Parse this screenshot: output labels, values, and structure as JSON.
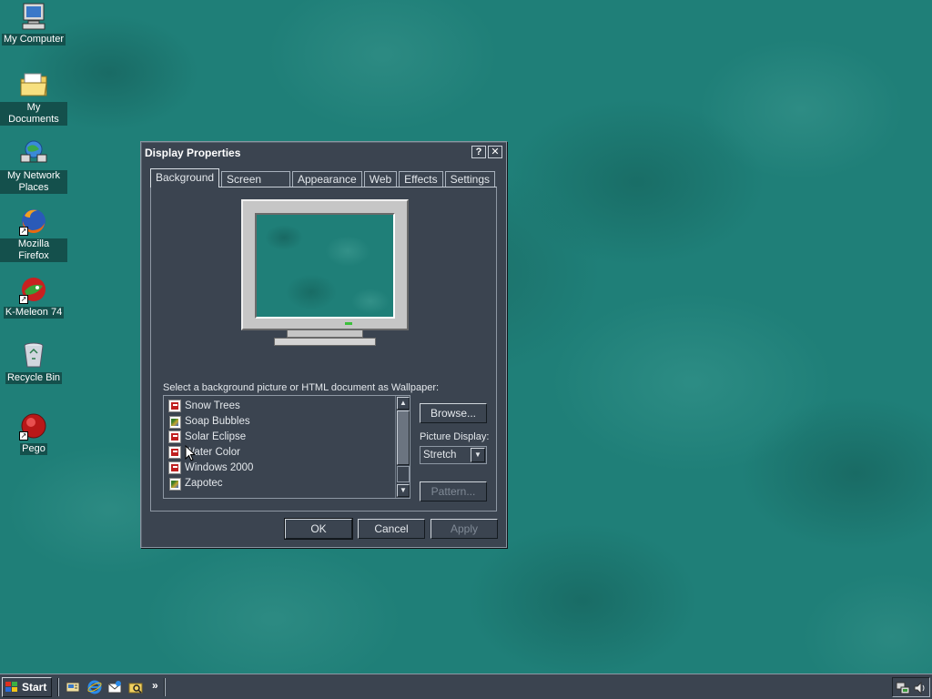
{
  "desktop": {
    "icons": [
      {
        "label": "My Computer",
        "icon": "computer-icon"
      },
      {
        "label": "My Documents",
        "icon": "folder-icon"
      },
      {
        "label": "My Network Places",
        "icon": "network-icon"
      },
      {
        "label": "Mozilla Firefox",
        "icon": "firefox-icon"
      },
      {
        "label": "K-Meleon 74",
        "icon": "kmeleon-icon"
      },
      {
        "label": "Recycle Bin",
        "icon": "recycle-bin-icon"
      },
      {
        "label": "Pego",
        "icon": "pego-icon"
      }
    ]
  },
  "window": {
    "title": "Display Properties",
    "help_glyph": "?",
    "close_glyph": "✕",
    "tabs": [
      "Background",
      "Screen Saver",
      "Appearance",
      "Web",
      "Effects",
      "Settings"
    ],
    "active_tab": "Background",
    "wallpaper_label": "Select a background picture or HTML document as Wallpaper:",
    "wallpapers": [
      {
        "name": "Snow Trees",
        "icon": "bitmap-icon"
      },
      {
        "name": "Soap Bubbles",
        "icon": "html-doc-icon"
      },
      {
        "name": "Solar Eclipse",
        "icon": "bitmap-icon"
      },
      {
        "name": "Water Color",
        "icon": "bitmap-icon"
      },
      {
        "name": "Windows 2000",
        "icon": "bitmap-icon"
      },
      {
        "name": "Zapotec",
        "icon": "html-doc-icon"
      }
    ],
    "browse_label": "Browse...",
    "picture_display_label": "Picture Display:",
    "picture_display_value": "Stretch",
    "pattern_label": "Pattern...",
    "ok_label": "OK",
    "cancel_label": "Cancel",
    "apply_label": "Apply"
  },
  "taskbar": {
    "start_label": "Start",
    "quick_launch": [
      "show-desktop-icon",
      "internet-explorer-icon",
      "outlook-express-icon",
      "explorer-icon"
    ],
    "overflow_glyph": "»"
  },
  "colors": {
    "desktop": "#1f7f78",
    "window_face": "#3b4450",
    "text": "#e4e8ec"
  }
}
